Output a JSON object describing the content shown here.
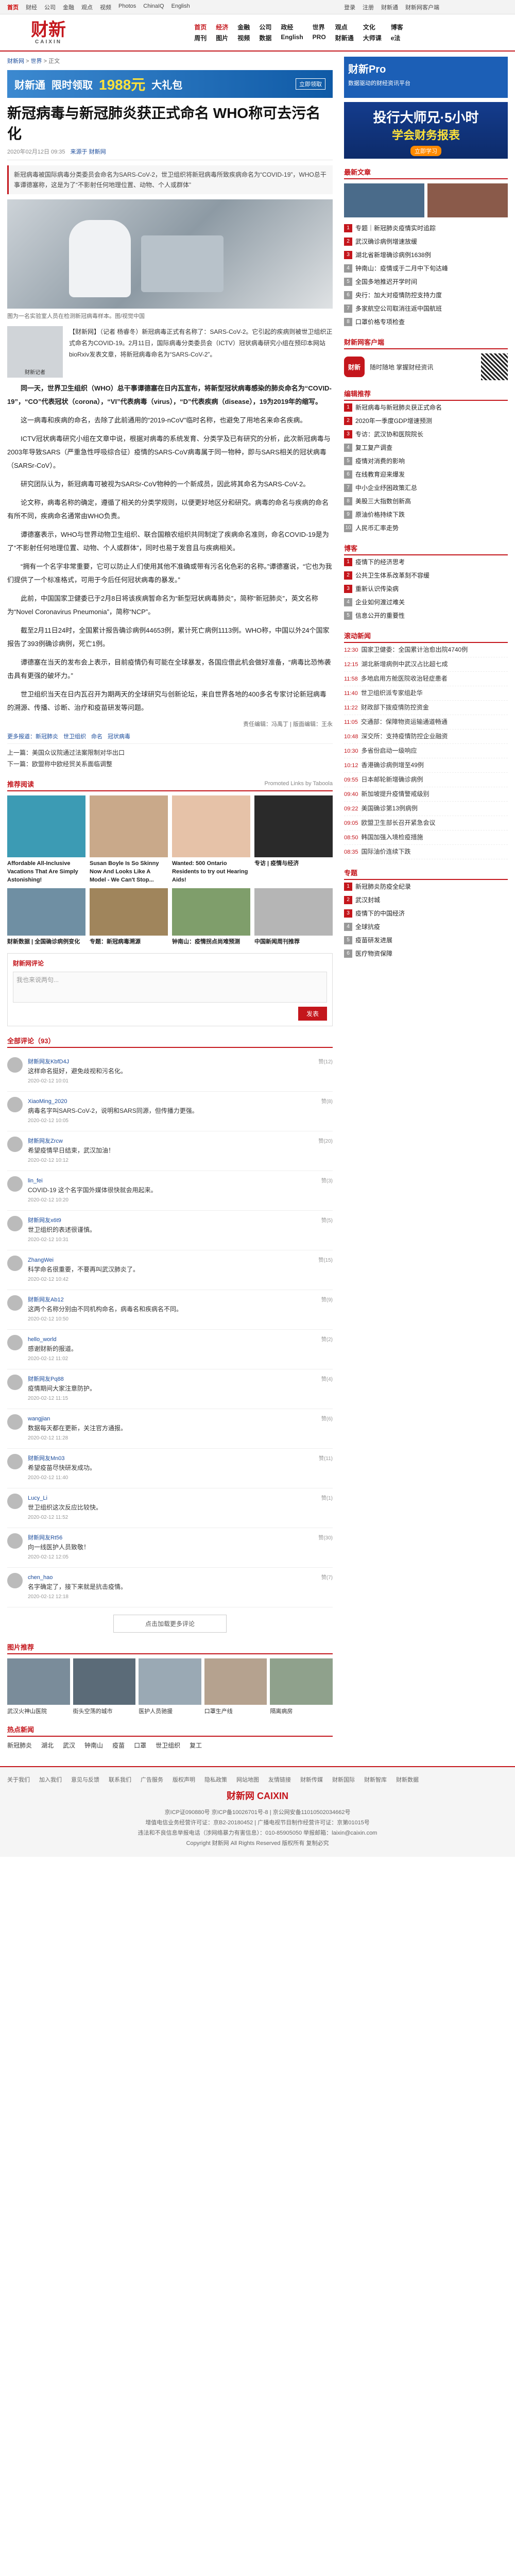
{
  "topbar": {
    "items": [
      "首页",
      "财经",
      "公司",
      "金融",
      "观点",
      "视频",
      "Photos",
      "ChinaIQ",
      "English"
    ],
    "right": [
      "登录",
      "注册",
      "财新通",
      "财新网客户端"
    ]
  },
  "header": {
    "logo_cn": "财新",
    "logo_en": "CAIXIN",
    "channels": [
      "首页",
      "经济",
      "金融",
      "公司",
      "政经",
      "世界",
      "观点",
      "文化",
      "博客",
      "周刊",
      "图片",
      "视频",
      "数据",
      "English",
      "PRO",
      "财新通",
      "大师课",
      "e法"
    ]
  },
  "crumbs": {
    "home": "财新网",
    "sep": " > ",
    "section": "世界",
    "extra": " > 正文"
  },
  "top_ad": {
    "brand": "财新通",
    "text": "限时领取",
    "big": "1988元",
    "text2": "大礼包",
    "tag": "立即领取"
  },
  "article": {
    "title": "新冠病毒与新冠肺炎获正式命名 WHO称可去污名化",
    "date": "2020年02月12日 09:35",
    "source": "来源于 财新网",
    "summary": "新冠病毒被国际病毒分类委员会命名为SARS-CoV-2，世卫组织将新冠病毒所致疾病命名为“COVID-19”，WHO总干事谭德塞称，这是为了“不影射任何地理位置、动物、个人或群体”",
    "hero_caption": "图为一名实验室人员在检测新冠病毒样本。图/视觉中国",
    "byline_pic_label": "财新记者",
    "byline_text": "【财新网】（记者 杨睿冬）新冠病毒正式有名称了：SARS-CoV-2。它引起的疾病则被世卫组织正式命名为COVID-19。2月11日，国际病毒分类委员会（ICTV）冠状病毒研究小组在预印本网站bioRxiv发表文章，将新冠病毒命名为“SARS-CoV-2”。",
    "paragraphs": [
      "同一天，世界卫生组织（WHO）总干事谭德塞在日内瓦宣布，将新型冠状病毒感染的肺炎命名为“COVID-19”，“CO”代表冠状（corona），“VI”代表病毒（virus），“D”代表疾病（disease），19为2019年的缩写。",
      "这一病毒和疾病的命名，去除了此前通用的“2019-nCoV”临时名称，也避免了用地名来命名疾病。",
      "ICTV冠状病毒研究小组在文章中说，根据对病毒的系统发育、分类学及已有研究的分析，此次新冠病毒与2003年导致SARS（严重急性呼吸综合征）疫情的SARS-CoV病毒属于同一物种，即与SARS相关的冠状病毒（SARSr-CoV）。",
      "研究团队认为，新冠病毒可被视为SARSr-CoV物种的一个新成员，因此将其命名为SARS-CoV-2。",
      "论文称，病毒名称的确定，遵循了相关的分类学规则，以便更好地区分和研究。病毒的命名与疾病的命名有所不同，疾病命名通常由WHO负责。",
      "谭德塞表示，WHO与世界动物卫生组织、联合国粮农组织共同制定了疾病命名准则，命名COVID-19是为了“不影射任何地理位置、动物、个人或群体”，同时也易于发音且与疾病相关。",
      "“拥有一个名字非常重要，它可以防止人们使用其他不准确或带有污名化色彩的名称。”谭德塞说，“它也为我们提供了一个标准格式，可用于今后任何冠状病毒的暴发。”",
      "此前，中国国家卫健委已于2月8日将该疾病暂命名为“新型冠状病毒肺炎”，简称“新冠肺炎”，英文名称为“Novel Coronavirus Pneumonia”，简称“NCP”。",
      "截至2月11日24时，全国累计报告确诊病例44653例，累计死亡病例1113例。WHO称，中国以外24个国家报告了393例确诊病例，死亡1例。",
      "谭德塞在当天的发布会上表示，目前疫情仍有可能在全球暴发，各国应借此机会做好准备，“病毒比恐怖袭击具有更强的破坏力。”",
      "世卫组织当天在日内瓦召开为期两天的全球研究与创新论坛，来自世界各地的400多名专家讨论新冠病毒的溯源、传播、诊断、治疗和疫苗研发等问题。"
    ],
    "end_note": "责任编辑：冯禹丁 | 版面编辑：王永",
    "tags_label": "更多报道：",
    "tags": [
      "新冠肺炎",
      "世卫组织",
      "命名",
      "冠状病毒"
    ],
    "prev": "上一篇：美国众议院通过法案限制对华出口",
    "next": "下一篇：欧盟称中欧经贸关系面临调整"
  },
  "recommend": {
    "title": "推荐阅读",
    "right": "Promoted Links by Taboola",
    "items": [
      "Affordable All-Inclusive Vacations That Are Simply Astonishing!",
      "Susan Boyle Is So Skinny Now And Looks Like A Model - We Can't Stop...",
      "Wanted: 500 Ontario Residents to try out Hearing Aids!",
      "专访 | 疫情与经济"
    ],
    "items2": [
      "财新数据 | 全国确诊病例变化",
      "专题：新冠病毒溯源",
      "钟南山：疫情拐点尚难预测",
      "中国新闻周刊推荐"
    ]
  },
  "comments": {
    "title": "财新网评论",
    "placeholder": "我也来说两句...",
    "submit": "发表",
    "count_label": "全部评论（93）",
    "list": [
      {
        "user": "财新网友KbfD4J",
        "text": "这样命名挺好，避免歧视和污名化。",
        "time": "2020-02-12 10:01",
        "likes": "赞(12)"
      },
      {
        "user": "XiaoMing_2020",
        "text": "病毒名字叫SARS-CoV-2，说明和SARS同源，但传播力更强。",
        "time": "2020-02-12 10:05",
        "likes": "赞(8)"
      },
      {
        "user": "财新网友Zrcw",
        "text": "希望疫情早日结束，武汉加油！",
        "time": "2020-02-12 10:12",
        "likes": "赞(20)"
      },
      {
        "user": "lin_fei",
        "text": "COVID-19 这个名字国外媒体很快就会用起来。",
        "time": "2020-02-12 10:20",
        "likes": "赞(3)"
      },
      {
        "user": "财新网友x6t9",
        "text": "世卫组织的表述很谨慎。",
        "time": "2020-02-12 10:31",
        "likes": "赞(5)"
      },
      {
        "user": "ZhangWei",
        "text": "科学命名很重要，不要再叫武汉肺炎了。",
        "time": "2020-02-12 10:42",
        "likes": "赞(15)"
      },
      {
        "user": "财新网友Ab12",
        "text": "这两个名称分别由不同机构命名，病毒名和疾病名不同。",
        "time": "2020-02-12 10:50",
        "likes": "赞(9)"
      },
      {
        "user": "hello_world",
        "text": "感谢财新的报道。",
        "time": "2020-02-12 11:02",
        "likes": "赞(2)"
      },
      {
        "user": "财新网友Pq88",
        "text": "疫情期间大家注意防护。",
        "time": "2020-02-12 11:15",
        "likes": "赞(4)"
      },
      {
        "user": "wangjian",
        "text": "数据每天都在更新，关注官方通报。",
        "time": "2020-02-12 11:28",
        "likes": "赞(6)"
      },
      {
        "user": "财新网友Mn03",
        "text": "希望疫苗尽快研发成功。",
        "time": "2020-02-12 11:40",
        "likes": "赞(11)"
      },
      {
        "user": "Lucy_Li",
        "text": "世卫组织这次反应比较快。",
        "time": "2020-02-12 11:52",
        "likes": "赞(1)"
      },
      {
        "user": "财新网友Rt56",
        "text": "向一线医护人员致敬！",
        "time": "2020-02-12 12:05",
        "likes": "赞(30)"
      },
      {
        "user": "chen_hao",
        "text": "名字确定了，接下来就是抗击疫情。",
        "time": "2020-02-12 12:18",
        "likes": "赞(7)"
      }
    ],
    "load_more": "点击加载更多评论"
  },
  "pics": {
    "title": "图片推荐",
    "items": [
      "武汉火神山医院",
      "街头空荡的城市",
      "医护人员驰援",
      "口罩生产线",
      "隔离病房"
    ]
  },
  "hot_news": {
    "title": "热点新闻",
    "items": [
      "新冠肺炎",
      "湖北",
      "武汉",
      "钟南山",
      "疫苗",
      "口罩",
      "世卫组织",
      "复工"
    ]
  },
  "right": {
    "ad1": {
      "l1": "财新Pro",
      "l2": "数据驱动的财经资讯平台"
    },
    "ad2": {
      "l1": "投行大师兄·5小时",
      "l2": "学会财务报表",
      "l3": "立即学习"
    },
    "news_title": "最新文章",
    "news": [
      {
        "n": "1",
        "top": true,
        "text": "专题｜新冠肺炎疫情实时追踪"
      },
      {
        "n": "2",
        "top": true,
        "text": "武汉确诊病例增速放缓"
      },
      {
        "n": "3",
        "top": true,
        "text": "湖北省新增确诊病例1638例"
      },
      {
        "n": "4",
        "top": false,
        "text": "钟南山：疫情或于二月中下旬达峰"
      },
      {
        "n": "5",
        "top": false,
        "text": "全国多地推迟开学时间"
      },
      {
        "n": "6",
        "top": false,
        "text": "央行：加大对疫情防控支持力度"
      },
      {
        "n": "7",
        "top": false,
        "text": "多家航空公司取消往返中国航班"
      },
      {
        "n": "8",
        "top": false,
        "text": "口罩价格专项检查"
      }
    ],
    "app_title": "财新网客户端",
    "app_text": "随时随地 掌握财经资讯",
    "app_icon": "财新",
    "rank_title": "编辑推荐",
    "rank": [
      {
        "n": "1",
        "top": true,
        "text": "新冠病毒与新冠肺炎获正式命名"
      },
      {
        "n": "2",
        "top": true,
        "text": "2020年一季度GDP增速预测"
      },
      {
        "n": "3",
        "top": true,
        "text": "专访：武汉协和医院院长"
      },
      {
        "n": "4",
        "top": false,
        "text": "复工复产调查"
      },
      {
        "n": "5",
        "top": false,
        "text": "疫情对消费的影响"
      },
      {
        "n": "6",
        "top": false,
        "text": "在线教育迎来爆发"
      },
      {
        "n": "7",
        "top": false,
        "text": "中小企业纾困政策汇总"
      },
      {
        "n": "8",
        "top": false,
        "text": "美股三大指数创新高"
      },
      {
        "n": "9",
        "top": false,
        "text": "原油价格持续下跌"
      },
      {
        "n": "10",
        "top": false,
        "text": "人民币汇率走势"
      }
    ],
    "blog_title": "博客",
    "blogs": [
      {
        "n": "1",
        "top": true,
        "text": "疫情下的经济思考"
      },
      {
        "n": "2",
        "top": true,
        "text": "公共卫生体系改革刻不容缓"
      },
      {
        "n": "3",
        "top": true,
        "text": "重新认识传染病"
      },
      {
        "n": "4",
        "top": false,
        "text": "企业如何渡过难关"
      },
      {
        "n": "5",
        "top": false,
        "text": "信息公开的重要性"
      }
    ],
    "timeline_title": "滚动新闻",
    "timeline": [
      {
        "tm": "12:30",
        "text": "国家卫健委：全国累计治愈出院4740例"
      },
      {
        "tm": "12:15",
        "text": "湖北新增病例中武汉占比超七成"
      },
      {
        "tm": "11:58",
        "text": "多地启用方舱医院收治轻症患者"
      },
      {
        "tm": "11:40",
        "text": "世卫组织派专家组赴华"
      },
      {
        "tm": "11:22",
        "text": "财政部下拨疫情防控资金"
      },
      {
        "tm": "11:05",
        "text": "交通部：保障物资运输通道畅通"
      },
      {
        "tm": "10:48",
        "text": "深交所：支持疫情防控企业融资"
      },
      {
        "tm": "10:30",
        "text": "多省份启动一级响应"
      },
      {
        "tm": "10:12",
        "text": "香港确诊病例增至49例"
      },
      {
        "tm": "09:55",
        "text": "日本邮轮新增确诊病例"
      },
      {
        "tm": "09:40",
        "text": "新加坡提升疫情警戒级别"
      },
      {
        "tm": "09:22",
        "text": "美国确诊第13例病例"
      },
      {
        "tm": "09:05",
        "text": "欧盟卫生部长召开紧急会议"
      },
      {
        "tm": "08:50",
        "text": "韩国加强入境检疫措施"
      },
      {
        "tm": "08:35",
        "text": "国际油价连续下跌"
      }
    ],
    "more_title": "专题",
    "more": [
      {
        "n": "1",
        "top": true,
        "text": "新冠肺炎防疫全纪录"
      },
      {
        "n": "2",
        "top": true,
        "text": "武汉封城"
      },
      {
        "n": "3",
        "top": true,
        "text": "疫情下的中国经济"
      },
      {
        "n": "4",
        "top": false,
        "text": "全球抗疫"
      },
      {
        "n": "5",
        "top": false,
        "text": "疫苗研发进展"
      },
      {
        "n": "6",
        "top": false,
        "text": "医疗物资保障"
      }
    ]
  },
  "footer": {
    "links": [
      "关于我们",
      "加入我们",
      "意见与反馈",
      "联系我们",
      "广告服务",
      "版权声明",
      "隐私政策",
      "网站地图",
      "友情链接",
      "财新传媒",
      "财新国际",
      "财新智库",
      "财新数据"
    ],
    "line1": "京ICP证090880号 京ICP备10026701号-8 | 京公网安备11010502034662号",
    "line2": "增值电信业务经营许可证：京B2-20180452 | 广播电视节目制作经营许可证：京第01015号",
    "line3": "违法和不良信息举报电话（涉网络暴力有害信息）：010-85905050 举报邮箱：laixin@caixin.com",
    "line4": "Copyright 财新网 All Rights Reserved 版权所有 复制必究",
    "logo": "财新网 CAIXIN"
  }
}
